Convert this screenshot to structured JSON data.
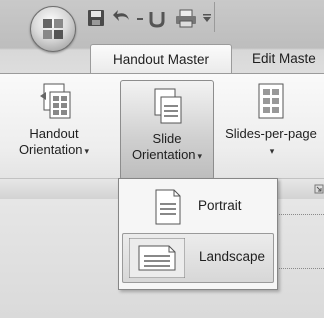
{
  "tabs": {
    "active": "Handout Master",
    "next": "Edit Maste"
  },
  "ribbon": {
    "handout_orientation": {
      "line1": "Handout",
      "line2": "Orientation"
    },
    "slide_orientation": {
      "line1": "Slide",
      "line2": "Orientation"
    },
    "slides_per_page": {
      "line1": "Slides-per-page"
    }
  },
  "menu": {
    "portrait": "Portrait",
    "landscape": "Landscape"
  },
  "icons": {
    "caret": "▾"
  }
}
